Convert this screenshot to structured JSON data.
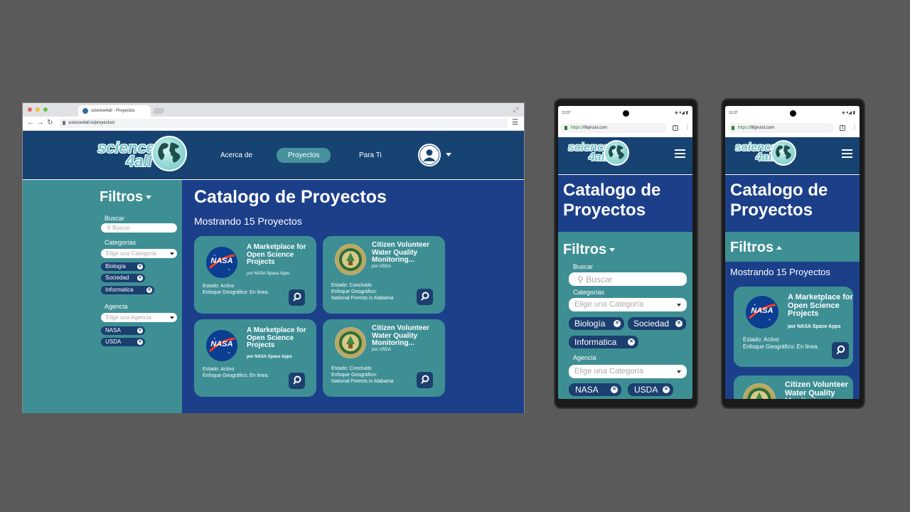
{
  "browser": {
    "tab_title": "science4all - Proyectos",
    "url": "science4all.io/proyectos/",
    "colors": {
      "dot_red": "#ee5f57",
      "dot_yellow": "#f6bd2f",
      "dot_green": "#5ec846"
    }
  },
  "brand": {
    "logo_line1": "science",
    "logo_line2": "4all"
  },
  "nav": {
    "about": "Acerca de",
    "projects": "Proyectos",
    "for_you": "Para Ti"
  },
  "filters": {
    "title": "Filtros",
    "search_label": "Buscar",
    "search_placeholder": "Buscar",
    "categories_label": "Categorías",
    "categories_placeholder": "Elige una Categoría",
    "category_chips": [
      "Biología",
      "Sociedad",
      "Informatica"
    ],
    "agency_label": "Agencia",
    "agency_placeholder_desktop": "Elige una Agencia",
    "agency_placeholder_mobile": "Elige una Categoría",
    "agency_chips": [
      "NASA",
      "USDA"
    ]
  },
  "catalog": {
    "title": "Catalogo de Proyectos",
    "title_mobile_line1": "Catalogo de",
    "title_mobile_line2": "Proyectos",
    "showing": "Mostrando 15 Proyectos"
  },
  "projects": [
    {
      "title_l1": "A Marketplace for",
      "title_l2": "Open Science",
      "title_l3": "Projects",
      "by": "por NASA Space Apps",
      "status": "Estado: Activo",
      "focus": "Enfoque Geográfico: En linea.",
      "focus_extra": "",
      "logo": "nasa-logo"
    },
    {
      "title_l1": "Citizen Volunteer",
      "title_l2": "Water Quality",
      "title_l3": "Monitoring...",
      "by": "por USDA",
      "status": "Estado: Concluido",
      "focus": "Enfoque Geográfico:",
      "focus_extra": "National Forests in Alabama",
      "logo": "usda-seal"
    }
  ],
  "phones": {
    "time": "13:37",
    "url_https": "https://",
    "url_host": "filipruisl.com",
    "tabs_count": "1"
  },
  "icons": [
    "search-icon",
    "user-avatar-icon",
    "hamburger-icon",
    "close-icon",
    "globe-icon",
    "lock-icon"
  ]
}
